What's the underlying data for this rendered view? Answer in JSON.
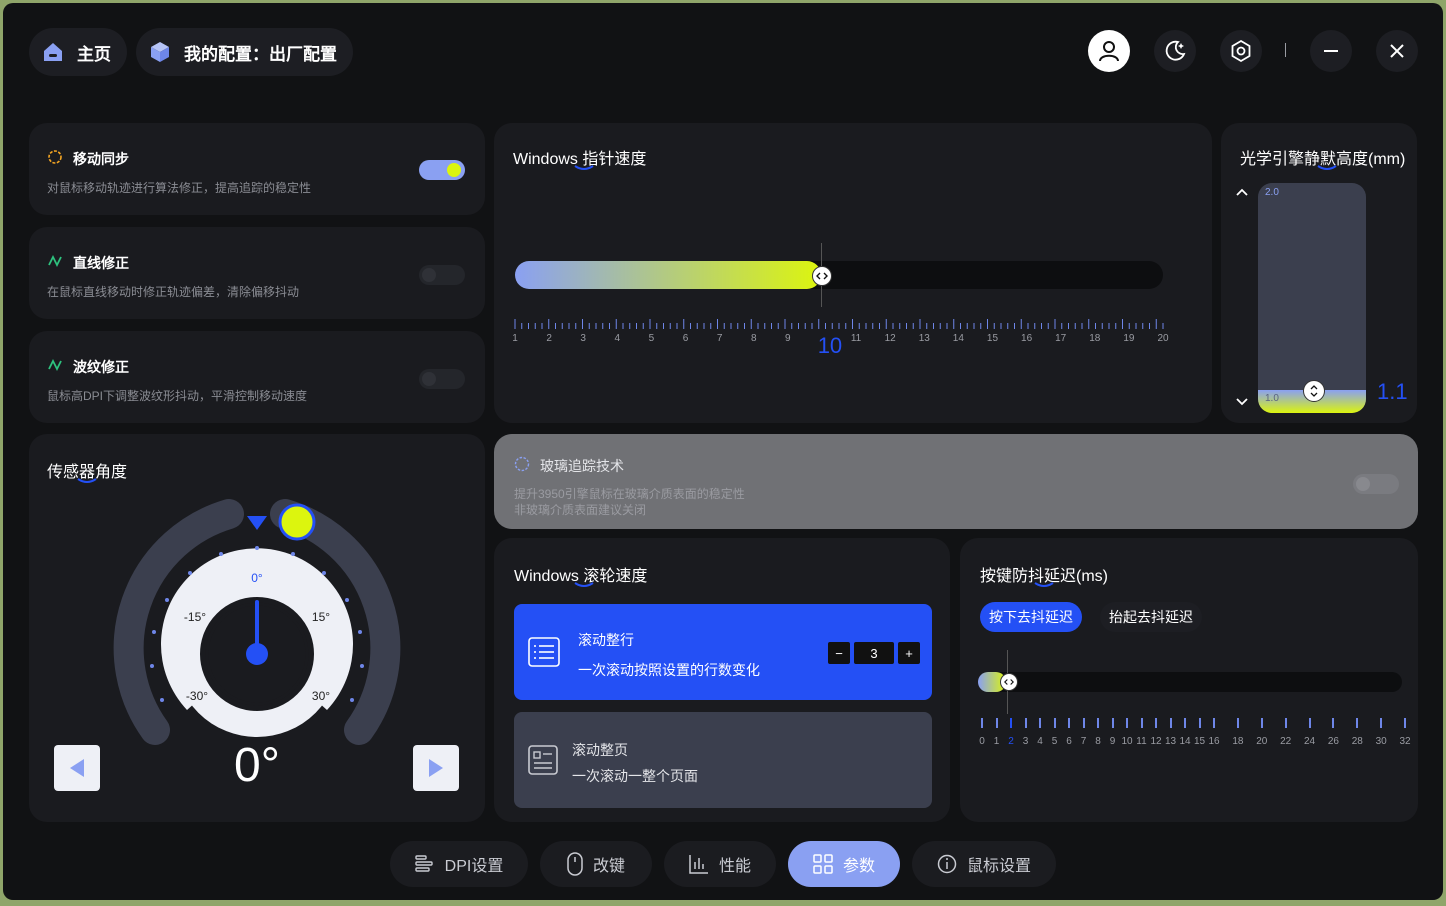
{
  "header": {
    "home_label": "主页",
    "config_label": "我的配置：出厂配置"
  },
  "features": {
    "motion_sync": {
      "title": "移动同步",
      "desc": "对鼠标移动轨迹进行算法修正，提高追踪的稳定性",
      "enabled": true
    },
    "angle_snap": {
      "title": "直线修正",
      "desc": "在鼠标直线移动时修正轨迹偏差，清除偏移抖动",
      "enabled": false
    },
    "ripple": {
      "title": "波纹修正",
      "desc": "鼠标高DPI下调整波纹形抖动，平滑控制移动速度",
      "enabled": false
    }
  },
  "pointer_speed": {
    "title": "Windows 指针速度",
    "value": "10",
    "min": 1,
    "max": 20,
    "ticks": [
      "1",
      "2",
      "3",
      "4",
      "5",
      "6",
      "7",
      "8",
      "9",
      "10",
      "11",
      "12",
      "13",
      "14",
      "15",
      "16",
      "17",
      "18",
      "19",
      "20"
    ]
  },
  "lod": {
    "title": "光学引擎静默高度(mm)",
    "max_label": "2.0",
    "min_label": "1.0",
    "value": "1.1",
    "fraction": 0.1
  },
  "glass": {
    "title": "玻璃追踪技术",
    "desc1": "提升3950引擎鼠标在玻璃介质表面的稳定性",
    "desc2": "非玻璃介质表面建议关闭",
    "enabled": false
  },
  "sensor_angle": {
    "title": "传感器角度",
    "value": "0°",
    "dial_labels": {
      "zero": "0°",
      "m15": "-15°",
      "p15": "15°",
      "m30": "-30°",
      "p30": "30°"
    }
  },
  "scroll_speed": {
    "title": "Windows 滚轮速度",
    "line_mode": {
      "title": "滚动整行",
      "desc": "一次滚动按照设置的行数变化"
    },
    "lines_value": "3",
    "minus": "−",
    "plus": "+",
    "page_mode": {
      "title": "滚动整页",
      "desc": "一次滚动一整个页面"
    }
  },
  "debounce": {
    "title": "按键防抖延迟(ms)",
    "press_label": "按下去抖延迟",
    "release_label": "抬起去抖延迟",
    "value": "2",
    "ticks": [
      "0",
      "1",
      "2",
      "3",
      "4",
      "5",
      "6",
      "7",
      "8",
      "9",
      "10",
      "11",
      "12",
      "13",
      "14",
      "15",
      "16",
      "18",
      "20",
      "22",
      "24",
      "26",
      "28",
      "30",
      "32"
    ]
  },
  "tabs": {
    "dpi": "DPI设置",
    "keys": "改键",
    "perf": "性能",
    "params": "参数",
    "mouse": "鼠标设置"
  },
  "colors": {
    "accent_blue": "#2450f5",
    "lime": "#dcf50e",
    "periwinkle": "#8aa0f2"
  }
}
